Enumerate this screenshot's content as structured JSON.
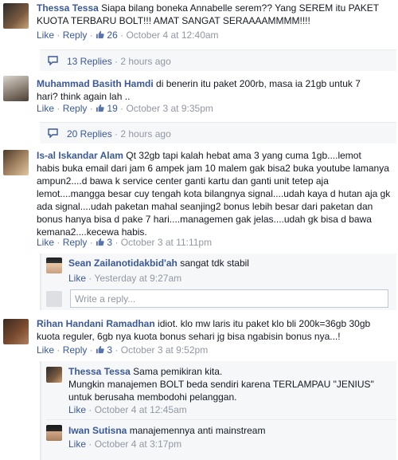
{
  "comments": [
    {
      "name": "Thessa Tessa",
      "text1": "Siapa bilang boneka Annabelle serem?? Yang SEREM itu PAKET",
      "text2": "KUOTA TERBARU BOLT!!! AMAT SANGAT SERAAAAMMMM!!!!",
      "like_label": "Like",
      "reply_label": "Reply",
      "likes": "26",
      "time": "October 4 at 12:40am",
      "replies_label": "13 Replies",
      "replies_time": "2 hours ago"
    },
    {
      "name": "Muhammad Basith Hamdi",
      "text1": "di benerin itu paket 200rb, masa ia 21gb untuk 7",
      "text2": "hari? think again lah ..",
      "like_label": "Like",
      "reply_label": "Reply",
      "likes": "19",
      "time": "October 3 at 9:35pm",
      "replies_label": "20 Replies",
      "replies_time": "2 hours ago"
    },
    {
      "name": "Is-al Iskandar Alam",
      "text1": "Qt 32gb tapi kalah hebat ama 3 yang cuma 1gb....lemot",
      "lines": [
        "habis buka email dari jam 6 ampek jam 10 malem gak bisa2 buka youtube lamanya",
        "ampun2....d bawa k service center ganti kartu dan ganti unit tetep aja",
        "lemot....mangga besar cuy tengah kota bilangnya signal....udah kaya d hutan aja gk",
        "ada signal....udah paketan mahal seanjing2 bonus lebih besar dari paketan dan",
        "bonus hanya bisa d pake 7 hari....managemen gak jelas....udah gk bisa d bawa",
        "kemana2....kecewa habis."
      ],
      "like_label": "Like",
      "reply_label": "Reply",
      "likes": "3",
      "time": "October 3 at 11:11pm",
      "reply": {
        "name": "Sean Zailanotidakbid'ah",
        "text": "sangat tdk stabil",
        "like_label": "Like",
        "time": "Yesterday at 9:27am"
      },
      "reply_placeholder": "Write a reply..."
    },
    {
      "name": "Rihan Handani Ramadhan",
      "text1": "idiot. klo mw laris itu paket klo bli 200k=36gb 30gb",
      "text2": "kuota reguler, 6gb nya kuota bonus sehari jg bisa ngabisin bonus nya...!",
      "like_label": "Like",
      "reply_label": "Reply",
      "likes": "3",
      "time": "October 3 at 9:52pm",
      "replies": [
        {
          "name": "Thessa Tessa",
          "text1": "Sama pemikiran kita.",
          "text2": "Mungkin manajemen BOLT beda sendiri karena TERLAMPAU \"JENIUS\"",
          "text3": "untuk berusaha membodohi pelanggan.",
          "like_label": "Like",
          "time": "October 4 at 12:45am"
        },
        {
          "name": "Iwan Sutisna",
          "text1": "manajemennya anti mainstream",
          "like_label": "Like",
          "time": "October 4 at 3:17pm"
        }
      ]
    }
  ],
  "colors": {
    "link": "#3b5998",
    "meta": "#9197a3",
    "panel": "#f6f7f9"
  }
}
